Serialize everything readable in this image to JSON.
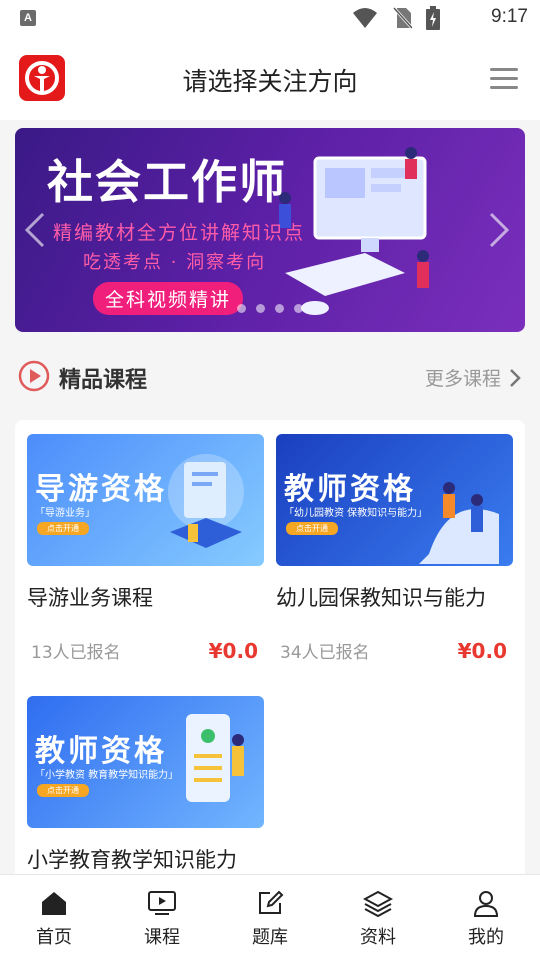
{
  "status_bar": {
    "notification_letter": "A",
    "time": "9:17"
  },
  "header": {
    "title": "请选择关注方向"
  },
  "banner": {
    "title": "社会工作师",
    "subtitle_1": "精编教材全方位讲解知识点",
    "subtitle_2": "吃透考点 · 洞察考向",
    "cta": "全科视频精讲",
    "slide_count": 4
  },
  "section": {
    "title": "精品课程",
    "more_label": "更多课程"
  },
  "courses": [
    {
      "thumb_title": "导游资格",
      "thumb_tag": "「导游业务」",
      "thumb_btn": "点击开通",
      "name": "导游业务课程",
      "enrolled": "13人已报名",
      "price": "¥0.0",
      "thumb_colors": [
        "#4c8dfb",
        "#7ec7ff"
      ]
    },
    {
      "thumb_title": "教师资格",
      "thumb_tag": "「幼儿园教资  保教知识与能力」",
      "thumb_btn": "点击开通",
      "name": "幼儿园保教知识与能力",
      "enrolled": "34人已报名",
      "price": "¥0.0",
      "thumb_colors": [
        "#1f49c9",
        "#3a7cf0"
      ]
    },
    {
      "thumb_title": "教师资格",
      "thumb_tag": "「小学教资  教育教学知识能力」",
      "thumb_btn": "点击开通",
      "name": "小学教育教学知识能力",
      "enrolled": "",
      "price": "",
      "thumb_colors": [
        "#2f6df0",
        "#6db0ff"
      ]
    }
  ],
  "tabbar": {
    "items": [
      {
        "label": "首页",
        "icon": "home-icon"
      },
      {
        "label": "课程",
        "icon": "video-icon"
      },
      {
        "label": "题库",
        "icon": "edit-icon"
      },
      {
        "label": "资料",
        "icon": "layers-icon"
      },
      {
        "label": "我的",
        "icon": "user-icon"
      }
    ]
  },
  "colors": {
    "brand_red": "#e41a1a",
    "price_red": "#e8382f",
    "banner_purple": "#5a1fa4"
  }
}
